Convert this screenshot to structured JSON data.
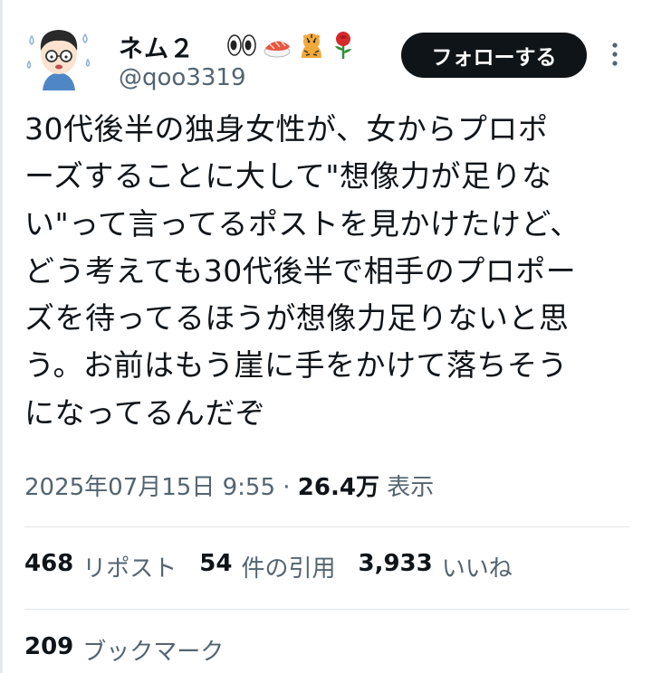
{
  "user": {
    "display_name": "ネム２",
    "name_emojis": [
      "eyes-icon",
      "sushi-icon",
      "tiger-icon",
      "rose-icon"
    ],
    "handle": "@qoo3319",
    "follow_label": "フォローする"
  },
  "tweet": {
    "lines": [
      "30代後半の独身女性が、女からプロポ",
      "ーズすることに大して\"想像力が足りな",
      "い\"って言ってるポストを見かけたけど、",
      "どう考えても30代後半で相手のプロポー",
      "ズを待ってるほうが想像力足りないと思",
      "う。お前はもう崖に手をかけて落ちそう",
      "になってるんだぞ"
    ]
  },
  "meta": {
    "datetime": "2025年07月15日 9:55",
    "separator": "·",
    "views_count": "26.4万",
    "views_label": "表示"
  },
  "stats": {
    "reposts_count": "468",
    "reposts_label": "リポスト",
    "quotes_count": "54",
    "quotes_label": "件の引用",
    "likes_count": "3,933",
    "likes_label": "いいね",
    "bookmarks_count": "209",
    "bookmarks_label": "ブックマーク"
  },
  "colors": {
    "text": "#0f1419",
    "secondary": "#536471",
    "button_bg": "#0f1419",
    "divider": "#e1e5e8"
  }
}
